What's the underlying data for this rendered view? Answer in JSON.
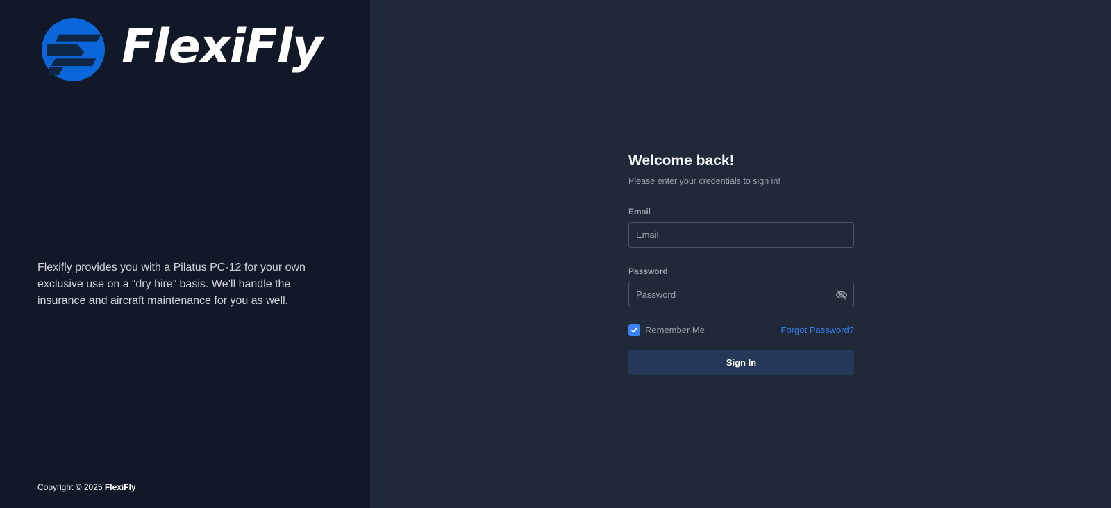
{
  "brand": {
    "name": "FlexiFly",
    "logo_color": "#0a66d9"
  },
  "left_panel": {
    "tagline": "Flexifly provides you with a Pilatus PC-12 for your own exclusive use on a “dry hire” basis. We’ll handle the insurance and aircraft maintenance for you as well.",
    "copyright_prefix": "Copyright © 2025",
    "copyright_brand": "FlexiFly"
  },
  "form": {
    "title": "Welcome back!",
    "subtitle": "Please enter your credentials to sign in!",
    "email": {
      "label": "Email",
      "placeholder": "Email",
      "value": ""
    },
    "password": {
      "label": "Password",
      "placeholder": "Password",
      "value": "",
      "toggle_icon": "eye-off-icon"
    },
    "remember_me": {
      "label": "Remember Me",
      "checked": true
    },
    "forgot_password_label": "Forgot Password?",
    "submit_label": "Sign In"
  },
  "colors": {
    "left_bg": "#111827",
    "right_bg": "#1f2937",
    "accent": "#3b82f6",
    "button_bg": "#253858"
  }
}
